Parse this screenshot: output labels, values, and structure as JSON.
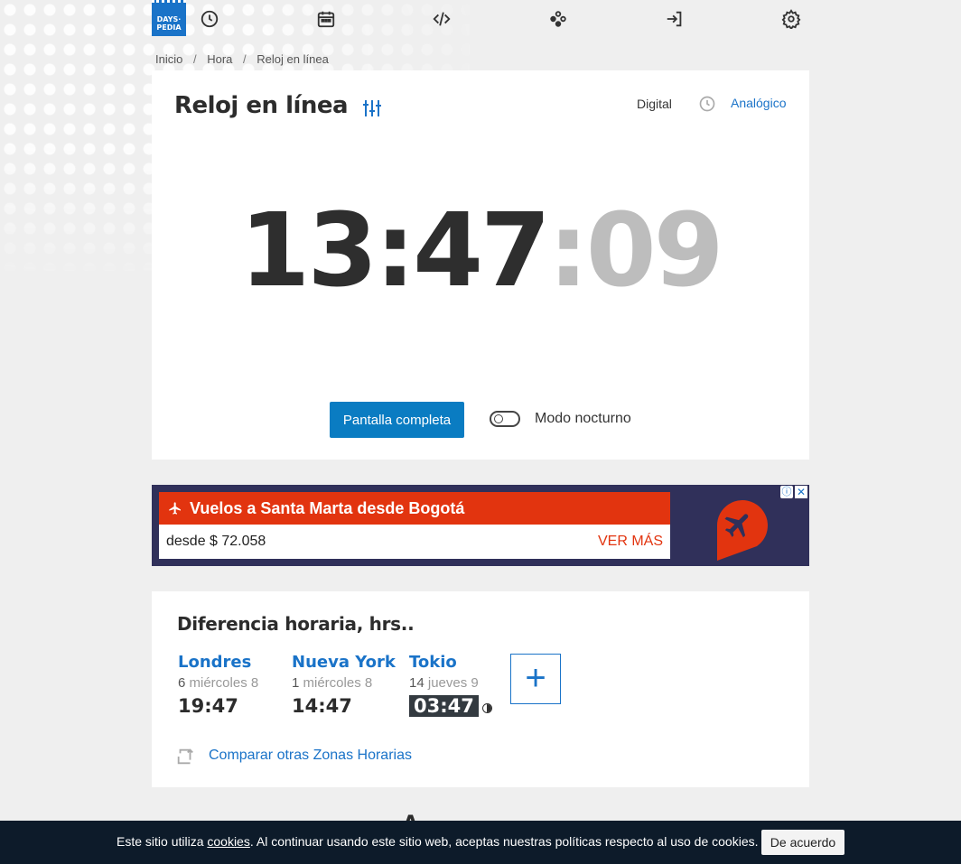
{
  "logo": {
    "line1": "DAYS·",
    "line2": "PEDIA"
  },
  "nav": {
    "items": [
      {
        "icon": "clock-icon"
      },
      {
        "icon": "calendar-icon"
      },
      {
        "icon": "code-icon"
      },
      {
        "icon": "game-icon"
      },
      {
        "icon": "login-icon"
      },
      {
        "icon": "gear-icon"
      }
    ]
  },
  "breadcrumb": {
    "items": [
      "Inicio",
      "Hora",
      "Reloj en línea"
    ],
    "separator": "/"
  },
  "clock": {
    "title": "Reloj en línea",
    "mode_digital": "Digital",
    "mode_analog": "Analógico",
    "hours": "13",
    "minutes": "47",
    "seconds": "09",
    "fullscreen_label": "Pantalla completa",
    "night_mode_label": "Modo nocturno",
    "night_mode_on": false
  },
  "ad": {
    "headline": "Vuelos a Santa Marta desde Bogotá",
    "price": "desde $ 72.058",
    "cta": "VER MÁS",
    "colors": {
      "accent": "#e2340f",
      "bg": "#30305a"
    }
  },
  "difference": {
    "title": "Diferencia horaria, hrs..",
    "cities": [
      {
        "name": "Londres",
        "offset": "6",
        "day": "miércoles 8",
        "time": "19:47",
        "night": false
      },
      {
        "name": "Nueva York",
        "offset": "1",
        "day": "miércoles 8",
        "time": "14:47",
        "night": false
      },
      {
        "name": "Tokio",
        "offset": "14",
        "day": "jueves 9",
        "time": "03:47",
        "night": true
      }
    ],
    "add_label": "+",
    "compare_label": "Comparar otras Zonas Horarias"
  },
  "cookie": {
    "text_before": "Este sitio utiliza ",
    "link": "cookies",
    "text_after": ". Al continuar usando este sitio web, aceptas nuestras políticas respecto al uso de cookies.",
    "button": "De acuerdo"
  },
  "peek_heading": "A",
  "colors": {
    "brand": "#1a73c8",
    "button": "#0a7cc2",
    "cookie_bg": "#0d1b2a"
  }
}
